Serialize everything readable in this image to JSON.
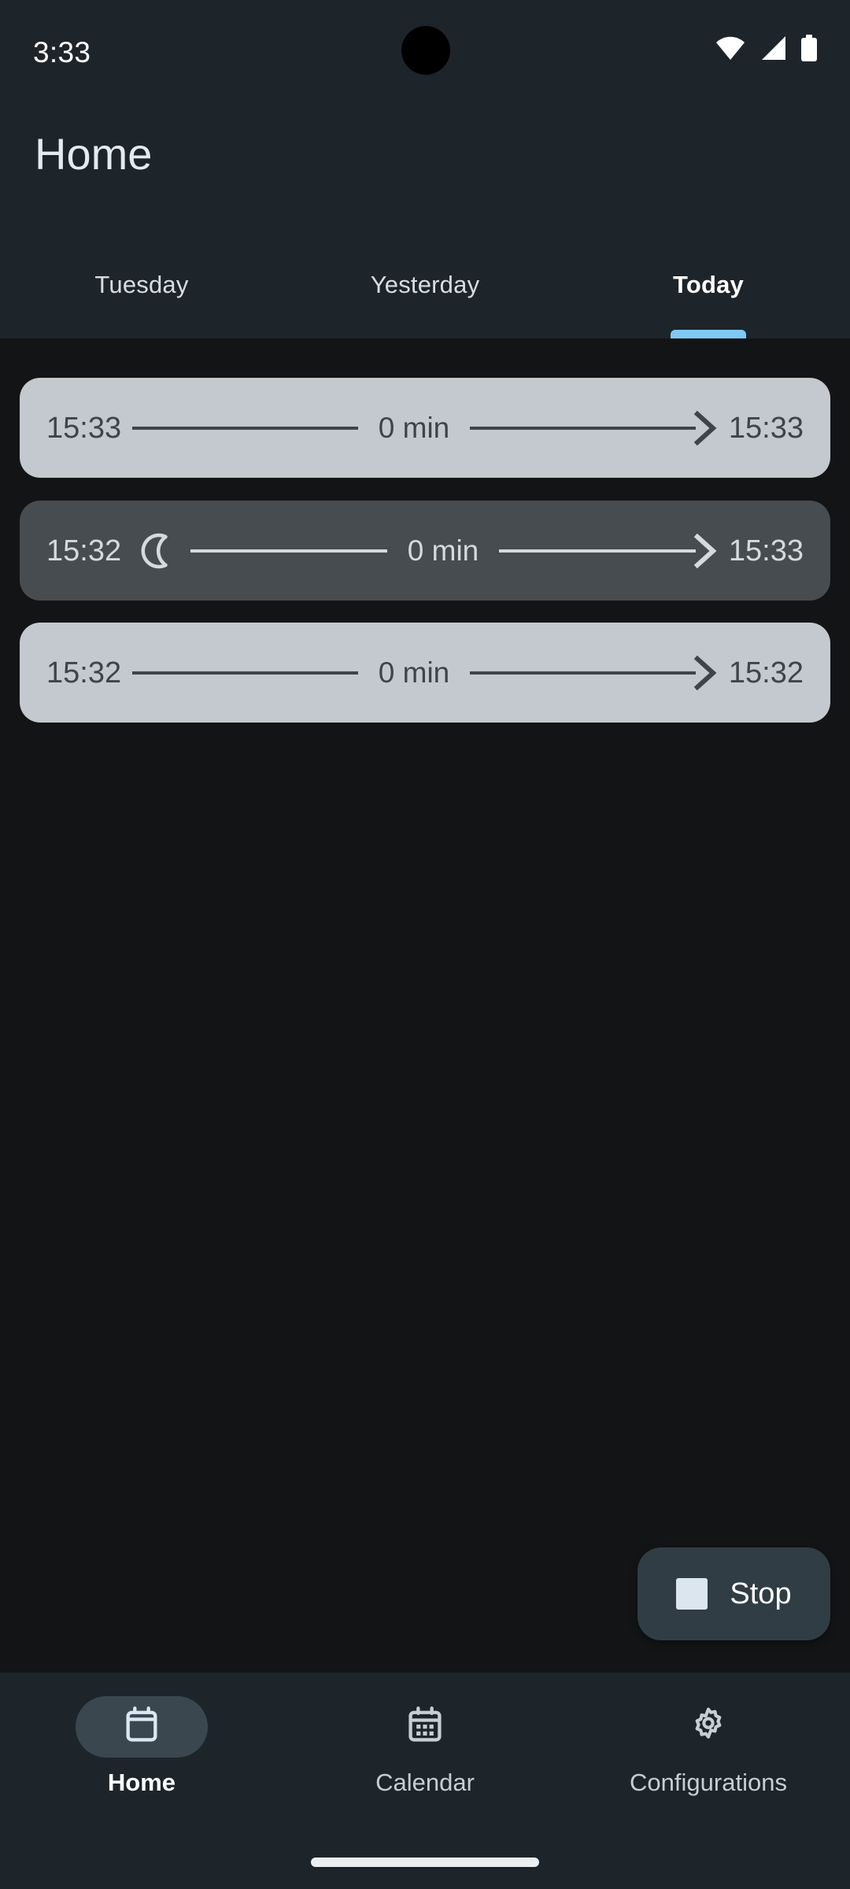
{
  "status_bar": {
    "clock": "3:33",
    "icons": [
      "wifi-icon",
      "cellular-signal-icon",
      "battery-icon"
    ]
  },
  "app_bar": {
    "title": "Home"
  },
  "tabs": {
    "active_index": 2,
    "indicator_color": "#7fc9f5",
    "items": [
      {
        "label": "Tuesday"
      },
      {
        "label": "Yesterday"
      },
      {
        "label": "Today"
      }
    ]
  },
  "entries": [
    {
      "start": "15:33",
      "duration": "0 min",
      "end": "15:33",
      "style": "light",
      "icon": null,
      "bg": "#c4c9d0",
      "fg": "#3d444b"
    },
    {
      "start": "15:32",
      "duration": "0 min",
      "end": "15:33",
      "style": "dark",
      "icon": "moon-icon",
      "bg": "#464c50",
      "fg": "#d6dade"
    },
    {
      "start": "15:32",
      "duration": "0 min",
      "end": "15:32",
      "style": "light",
      "icon": null,
      "bg": "#c4c9d0",
      "fg": "#3d444b"
    }
  ],
  "fab": {
    "label": "Stop",
    "icon": "stop-square-icon",
    "bg": "#303d45"
  },
  "bottom_nav": {
    "active_index": 0,
    "items": [
      {
        "label": "Home",
        "icon": "event-calendar-icon"
      },
      {
        "label": "Calendar",
        "icon": "calendar-month-icon"
      },
      {
        "label": "Configurations",
        "icon": "gear-icon"
      }
    ]
  }
}
